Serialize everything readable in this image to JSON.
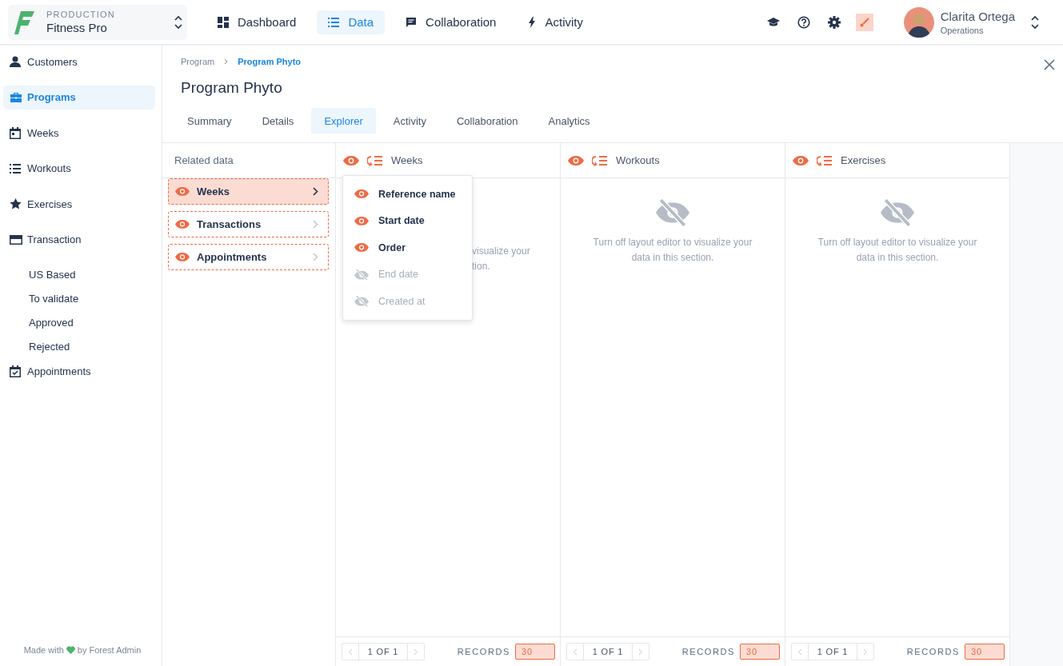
{
  "workspace": {
    "environment": "PRODUCTION",
    "project": "Fitness Pro"
  },
  "nav": [
    {
      "label": "Dashboard",
      "selected": false
    },
    {
      "label": "Data",
      "selected": true
    },
    {
      "label": "Collaboration",
      "selected": false
    },
    {
      "label": "Activity",
      "selected": false
    }
  ],
  "toolbar": {
    "layout_editor_on": true
  },
  "user": {
    "name": "Clarita Ortega",
    "team": "Operations"
  },
  "sidebar": {
    "items": [
      {
        "label": "Customers",
        "selected": false
      },
      {
        "label": "Programs",
        "selected": true
      },
      {
        "label": "Weeks",
        "selected": false
      },
      {
        "label": "Workouts",
        "selected": false
      },
      {
        "label": "Exercises",
        "selected": false
      },
      {
        "label": "Transaction",
        "selected": false,
        "children": [
          {
            "label": "US Based",
            "selected": false
          },
          {
            "label": "To validate",
            "selected": false
          },
          {
            "label": "Approved",
            "selected": false
          },
          {
            "label": "Rejected",
            "selected": false
          }
        ]
      },
      {
        "label": "Appointments",
        "selected": false
      }
    ],
    "footer_before": "Made with",
    "footer_after": "by Forest Admin"
  },
  "breadcrumb": [
    "Program",
    "Program Phyto"
  ],
  "title": "Program Phyto",
  "tabs": [
    {
      "label": "Summary",
      "selected": false
    },
    {
      "label": "Details",
      "selected": false
    },
    {
      "label": "Explorer",
      "selected": true
    },
    {
      "label": "Activity",
      "selected": false
    },
    {
      "label": "Collaboration",
      "selected": false
    },
    {
      "label": "Analytics",
      "selected": false
    }
  ],
  "related": {
    "heading": "Related data",
    "items": [
      {
        "label": "Weeks",
        "selected": true
      },
      {
        "label": "Transactions",
        "selected": false
      },
      {
        "label": "Appointments",
        "selected": false
      }
    ]
  },
  "columns": [
    {
      "title": "Weeks",
      "covered": true,
      "message_lines": [
        "visualize your",
        "tion."
      ],
      "pager": "1 OF 1",
      "records_label": "RECORDS",
      "records": "30",
      "field_menu": [
        {
          "label": "Reference name",
          "visible": true
        },
        {
          "label": "Start date",
          "visible": true
        },
        {
          "label": "Order",
          "visible": true
        },
        {
          "label": "End date",
          "visible": false
        },
        {
          "label": "Created at",
          "visible": false
        }
      ]
    },
    {
      "title": "Workouts",
      "covered": false,
      "message_lines": [
        "Turn off layout editor to visualize your",
        "data in this section."
      ],
      "pager": "1 OF 1",
      "records_label": "RECORDS",
      "records": "30"
    },
    {
      "title": "Exercises",
      "covered": false,
      "message_lines": [
        "Turn off layout editor to visualize your",
        "data in this section."
      ],
      "pager": "1 OF 1",
      "records_label": "RECORDS",
      "records": "30"
    }
  ]
}
